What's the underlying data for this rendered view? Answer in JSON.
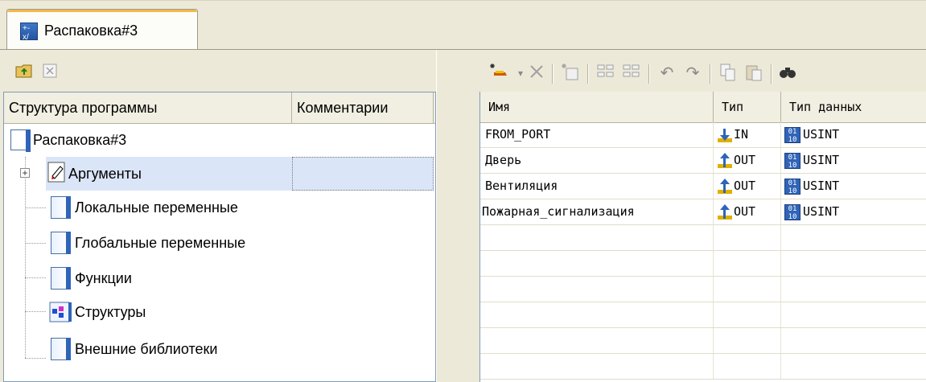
{
  "tab": {
    "title": "Распаковка#3",
    "icon": "function-block-icon"
  },
  "left": {
    "toolbar": {
      "folder_icon": "folder-up-icon",
      "close_icon": "close-icon"
    },
    "columns": [
      "Структура программы",
      "Комментарии"
    ],
    "root": "Распаковка#3",
    "items": [
      {
        "label": "Аргументы",
        "icon": "arguments-icon"
      },
      {
        "label": "Локальные переменные",
        "icon": "document-icon"
      },
      {
        "label": "Глобальные переменные",
        "icon": "document-icon"
      },
      {
        "label": "Функции",
        "icon": "document-icon"
      },
      {
        "label": "Структуры",
        "icon": "structures-icon"
      },
      {
        "label": "Внешние библиотеки",
        "icon": "document-icon"
      }
    ]
  },
  "right": {
    "toolbar": {
      "icons": [
        "new-variable-icon",
        "delete-icon",
        "insert-icon",
        "move-up-icon",
        "move-down-icon",
        "undo-icon",
        "redo-icon",
        "copy-icon",
        "paste-icon",
        "find-icon"
      ]
    },
    "columns": [
      "Имя",
      "Тип",
      "Тип данных"
    ],
    "rows": [
      {
        "name": "FROM_PORT",
        "type": "IN",
        "datatype": "USINT"
      },
      {
        "name": "Дверь",
        "type": "OUT",
        "datatype": "USINT"
      },
      {
        "name": "Вентиляция",
        "type": "OUT",
        "datatype": "USINT"
      },
      {
        "name": "Пожарная_сигнализация",
        "type": "OUT",
        "datatype": "USINT"
      }
    ]
  }
}
